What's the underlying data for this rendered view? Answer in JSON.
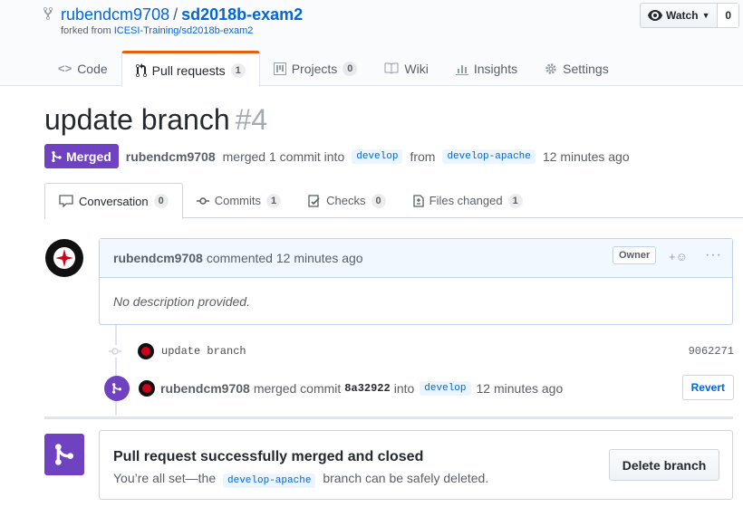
{
  "repo": {
    "owner": "rubendcm9708",
    "separator": "/",
    "name": "sd2018b-exam2",
    "fork_prefix": "forked from",
    "fork_source": "ICESI-Training/sd2018b-exam2"
  },
  "watch": {
    "label": "Watch",
    "count": "0"
  },
  "tabs": [
    {
      "label": "Code",
      "icon": "code-icon"
    },
    {
      "label": "Pull requests",
      "count": "1",
      "icon": "pull-request-icon"
    },
    {
      "label": "Projects",
      "count": "0",
      "icon": "project-icon"
    },
    {
      "label": "Wiki",
      "icon": "book-icon"
    },
    {
      "label": "Insights",
      "icon": "graph-icon"
    },
    {
      "label": "Settings",
      "icon": "gear-icon"
    }
  ],
  "pr": {
    "title": "update branch",
    "number": "#4",
    "state": "Merged",
    "author": "rubendcm9708",
    "merged_text": "merged 1 commit into",
    "base_branch": "develop",
    "from_text": "from",
    "head_branch": "develop-apache",
    "time": "12 minutes ago"
  },
  "pr_tabs": [
    {
      "label": "Conversation",
      "count": "0"
    },
    {
      "label": "Commits",
      "count": "1"
    },
    {
      "label": "Checks",
      "count": "0"
    },
    {
      "label": "Files changed",
      "count": "1"
    }
  ],
  "comment": {
    "author": "rubendcm9708",
    "action": "commented 12 minutes ago",
    "badge": "Owner",
    "body": "No description provided."
  },
  "commit": {
    "message": "update branch",
    "sha": "9062271"
  },
  "merge_event": {
    "author": "rubendcm9708",
    "text1": "merged commit",
    "sha": "8a32922",
    "text2": "into",
    "branch": "develop",
    "time": "12 minutes ago",
    "revert_label": "Revert"
  },
  "merge_box": {
    "title": "Pull request successfully merged and closed",
    "desc_before": "You’re all set—the",
    "branch": "develop-apache",
    "desc_after": "branch can be safely deleted.",
    "button": "Delete branch"
  },
  "colors": {
    "merged": "#6f42c1",
    "link": "#0366d6",
    "selected_tab_border": "#e36209"
  }
}
